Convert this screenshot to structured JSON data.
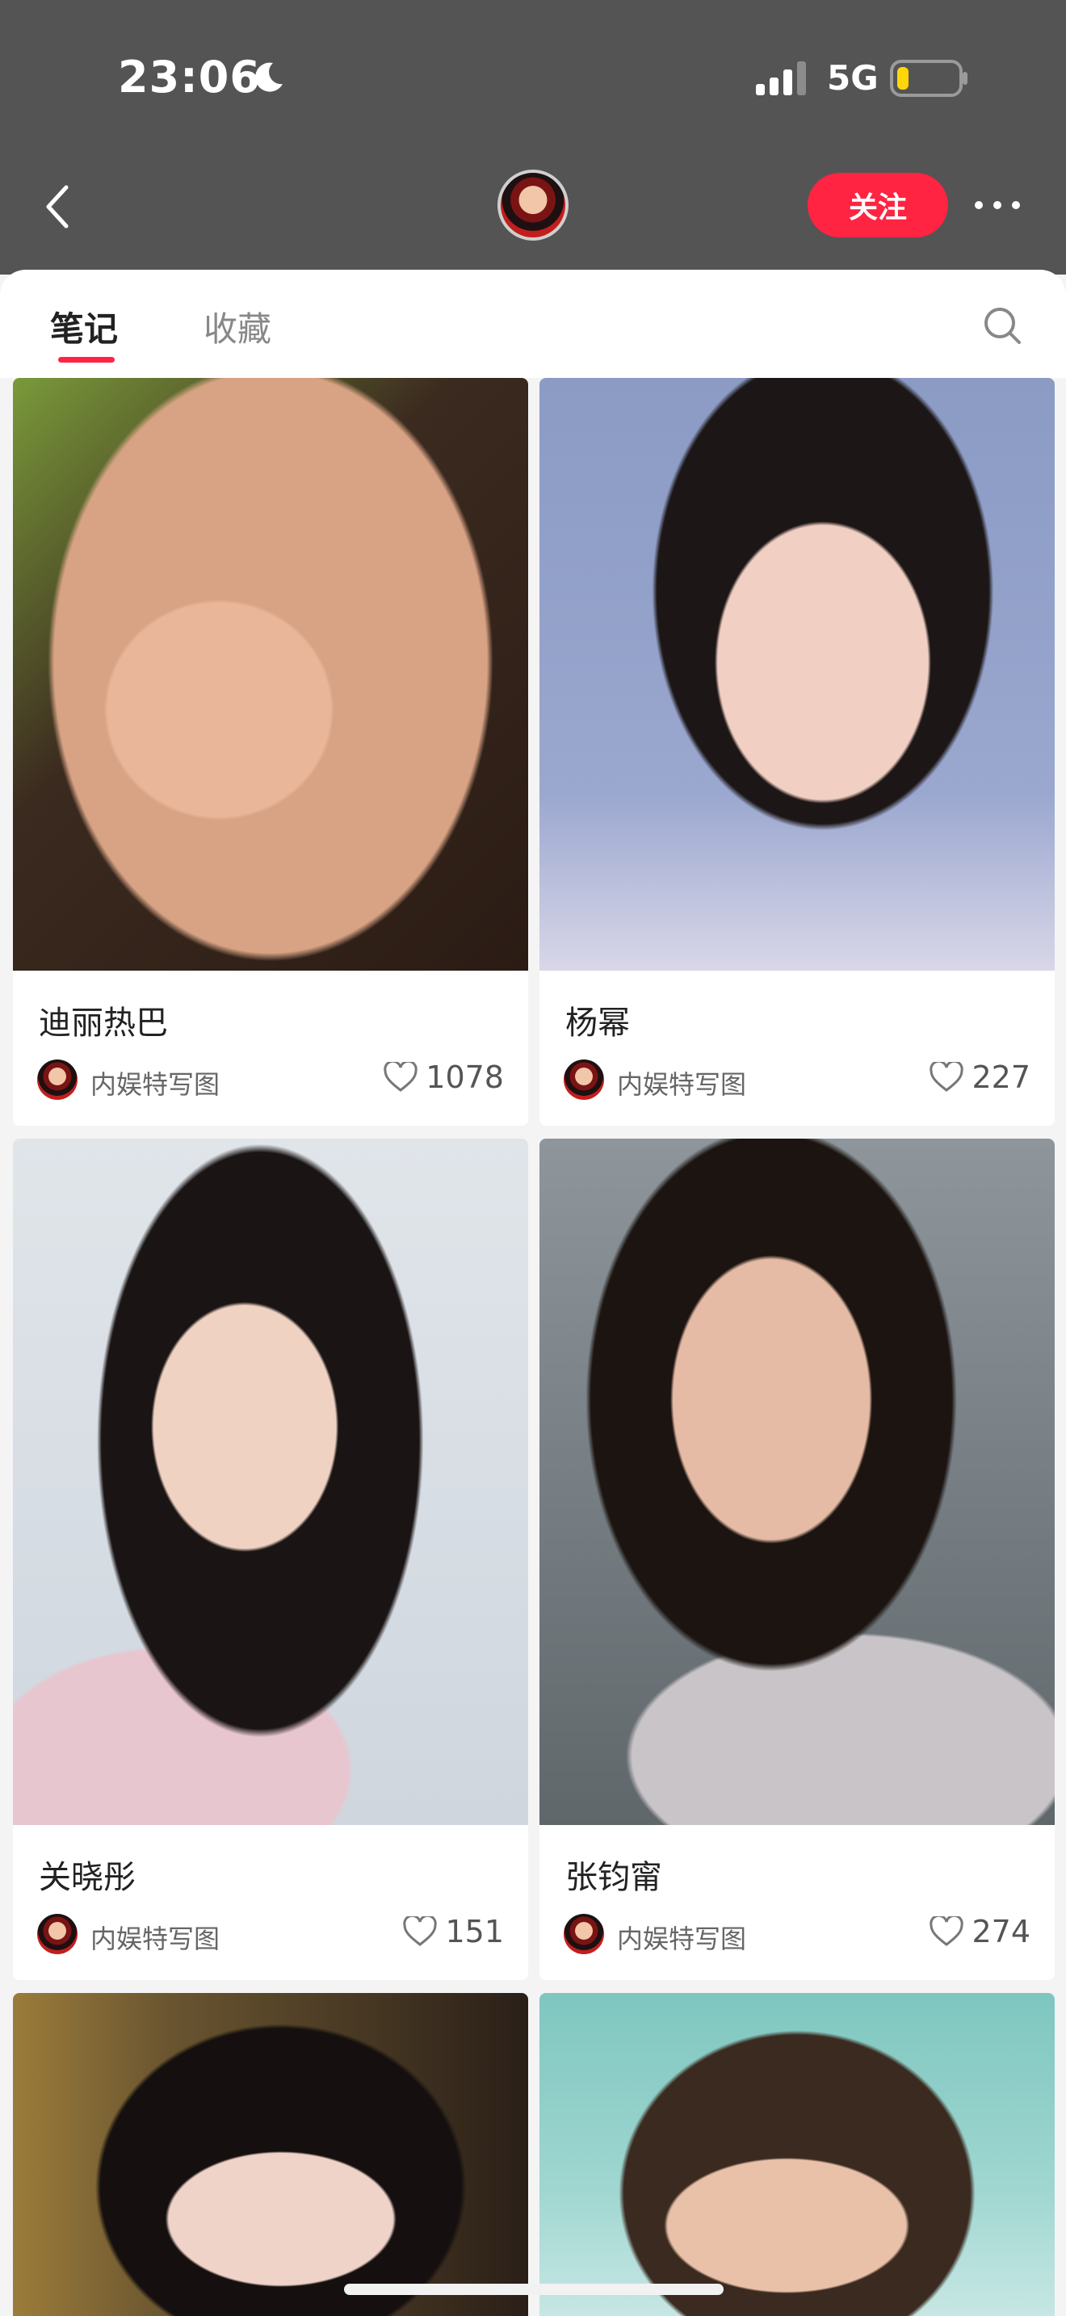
{
  "status_bar": {
    "time": "23:06",
    "network": "5G",
    "battery_level": 0.2,
    "icons": [
      "moon-icon",
      "signal-icon",
      "battery-icon"
    ]
  },
  "header": {
    "follow_label": "关注",
    "icons": [
      "back-icon",
      "more-icon"
    ]
  },
  "tabs": {
    "items": [
      {
        "label": "笔记",
        "active": true
      },
      {
        "label": "收藏",
        "active": false
      }
    ],
    "search_icon": "search-icon"
  },
  "colors": {
    "accent": "#ff2442",
    "header_bg": "#545454",
    "feed_bg": "#f4f4f4"
  },
  "feed": {
    "cards": [
      {
        "title": "迪丽热巴",
        "author": "内娱特写图",
        "likes": "1078"
      },
      {
        "title": "杨幂",
        "author": "内娱特写图",
        "likes": "227"
      },
      {
        "title": "关晓彤",
        "author": "内娱特写图",
        "likes": "151"
      },
      {
        "title": "张钧甯",
        "author": "内娱特写图",
        "likes": "274"
      }
    ]
  }
}
